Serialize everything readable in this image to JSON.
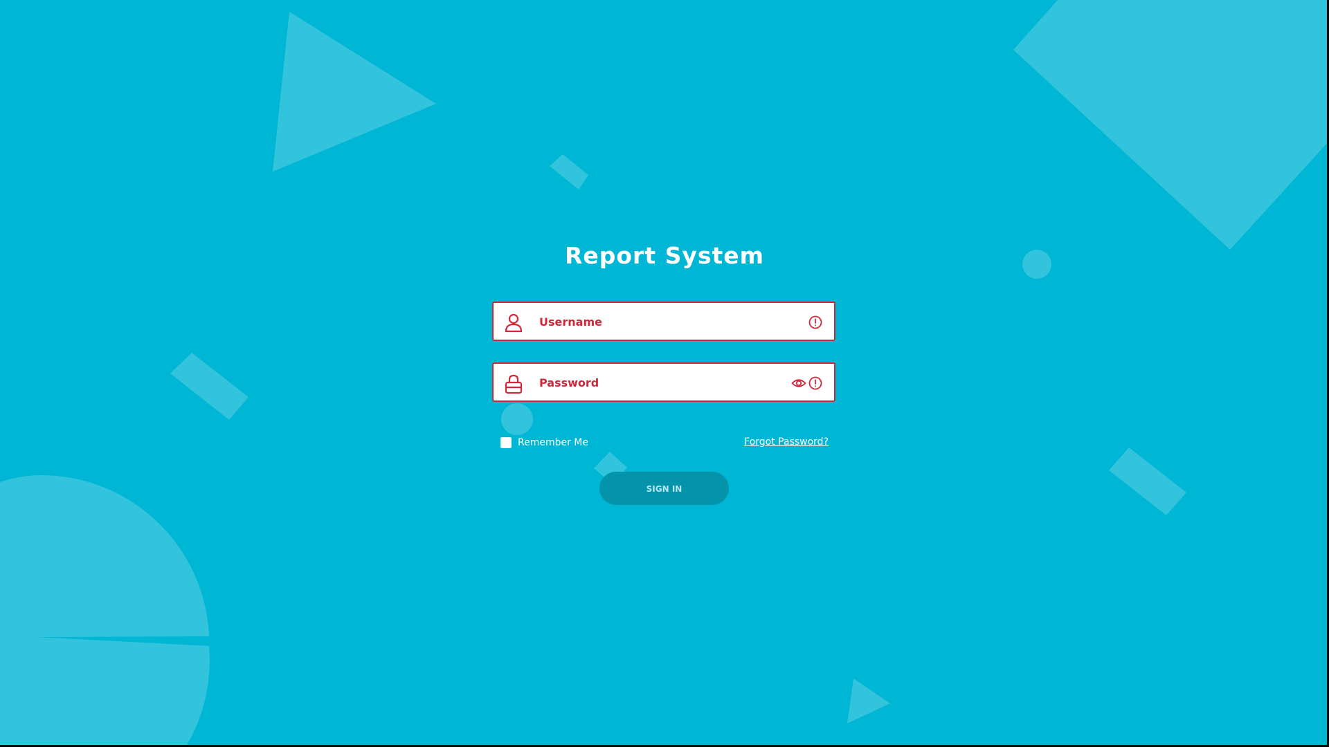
{
  "app": {
    "title": "Report System"
  },
  "login_form": {
    "username": {
      "placeholder": "Username",
      "value": "",
      "icon": "user-icon",
      "status_icon": "alert-circle-icon"
    },
    "password": {
      "placeholder": "Password",
      "value": "",
      "icon": "lock-icon",
      "reveal_icon": "eye-icon",
      "status_icon": "alert-circle-icon"
    },
    "remember_me": {
      "label": "Remember Me",
      "checked": false
    },
    "forgot_password_label": "Forgot Password?",
    "sign_in_label": "SIGN IN"
  },
  "colors": {
    "background": "#00b6d5",
    "error": "#d1273b",
    "button": "#0394aa",
    "button_text": "#b9e6ee",
    "text": "#ffffff"
  }
}
